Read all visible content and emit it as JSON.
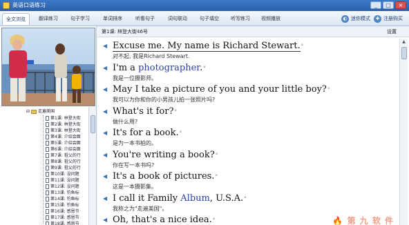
{
  "window": {
    "title": "英语口语练习"
  },
  "tabs": [
    {
      "label": "全文浏览",
      "active": true
    },
    {
      "label": "翻译练习"
    },
    {
      "label": "句子学习"
    },
    {
      "label": "单词排序"
    },
    {
      "label": "听看句子"
    },
    {
      "label": "词句联动"
    },
    {
      "label": "句子填空"
    },
    {
      "label": "听写练习"
    },
    {
      "label": "视频播放"
    }
  ],
  "mode_buttons": [
    {
      "label": "迷你模式",
      "icon": "mini-mode-icon"
    },
    {
      "label": "注册购买",
      "icon": "register-icon"
    }
  ],
  "lesson": {
    "title": "第1课: 林登大街46号",
    "settings_label": "设置"
  },
  "tree": {
    "root": "走遍美国",
    "items": [
      "第1课: 林登大街",
      "第2课: 林登大街",
      "第3课: 林登大街",
      "第4课: 介绍会面",
      "第5课: 介绍会面",
      "第6课: 介绍会面",
      "第7课: 祖父的行",
      "第8课: 祖父的行",
      "第9课: 祖父的行",
      "第10课: 没问题",
      "第11课: 没问题",
      "第12课: 没问题",
      "第13课: 钓鱼标",
      "第14课: 钓鱼标",
      "第15课: 钓鱼标",
      "第16课: 感恩节",
      "第17课: 感恩节",
      "第18课: 感恩节"
    ]
  },
  "sentences": [
    {
      "en": [
        {
          "t": "Excuse me. My name is Richard Stewart.",
          "c": "sel"
        }
      ],
      "zh": "对不起, 我是Richard Stewart."
    },
    {
      "en": [
        {
          "t": "I'm a "
        },
        {
          "t": "photographer",
          "c": "hl"
        },
        {
          "t": "."
        }
      ],
      "zh": "我是一位摄影师。"
    },
    {
      "en": [
        {
          "t": "May I take a picture of you and your little boy?"
        }
      ],
      "zh": "我可以为你和你的小男孩儿拍一张照片吗?"
    },
    {
      "en": [
        {
          "t": "What's it for?"
        }
      ],
      "zh": "做什么用?"
    },
    {
      "en": [
        {
          "t": "It's for a book."
        }
      ],
      "zh": "是为一本书拍的。"
    },
    {
      "en": [
        {
          "t": "You're writing a book?"
        }
      ],
      "zh": "你在写一本书吗?"
    },
    {
      "en": [
        {
          "t": "It's a book of pictures."
        }
      ],
      "zh": "这是一本摄影集。"
    },
    {
      "en": [
        {
          "t": "I call it Family "
        },
        {
          "t": "Album",
          "c": "hl"
        },
        {
          "t": ", U.S.A."
        }
      ],
      "zh": "我称之为\"走遍美国\"。"
    },
    {
      "en": [
        {
          "t": "Oh, that's a nice idea."
        }
      ],
      "zh": ""
    }
  ],
  "watermark": "🔥 第 九 软 件"
}
